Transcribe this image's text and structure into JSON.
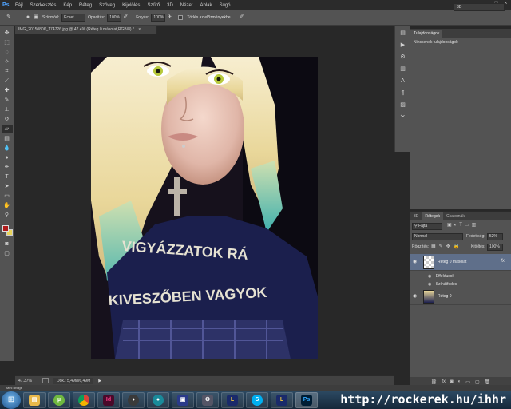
{
  "app": {
    "logo": "Ps",
    "menu": [
      "Fájl",
      "Szerkesztés",
      "Kép",
      "Réteg",
      "Szöveg",
      "Kijelölés",
      "Szűrő",
      "3D",
      "Nézet",
      "Ablak",
      "Súgó"
    ]
  },
  "options_bar": {
    "mode_label": "Színmód:",
    "mode_value": "Ecset",
    "opacity_label": "Opacitás:",
    "opacity_value": "100%",
    "flow_label": "Folyás:",
    "flow_value": "100%",
    "history_label": "Törlés az előzményekbe",
    "workspace_value": "3D"
  },
  "document": {
    "tab_title": "IMG_20150806_174726.jpg @ 47.4% (Réteg 0 másolat,RGB/8) *",
    "zoom": "47.37%",
    "doc_size": "Dok.: 5,49M/6,49M"
  },
  "properties_panel": {
    "tab": "Tulajdonságok",
    "empty_text": "Nincsenek tulajdonságok"
  },
  "layers_panel": {
    "tabs": [
      "3D",
      "Rétegek",
      "Csatornák"
    ],
    "filter_value": "Fajta",
    "blend_mode": "Normal",
    "opacity_label": "Fedettség:",
    "opacity_value": "52%",
    "lock_label": "Rögzítés:",
    "fill_label": "Kitöltés:",
    "fill_value": "100%",
    "layers": [
      {
        "name": "Réteg 0 másolat",
        "fx": "fx"
      },
      {
        "name": "Réteg 0"
      }
    ],
    "effects_label": "Effektusok",
    "effect_name": "Színátfedés"
  },
  "status_bar": {
    "mini_bridge": "Mini Bridge"
  },
  "taskbar": {
    "tray_text": "http://rockerek.hu/ihhr"
  }
}
